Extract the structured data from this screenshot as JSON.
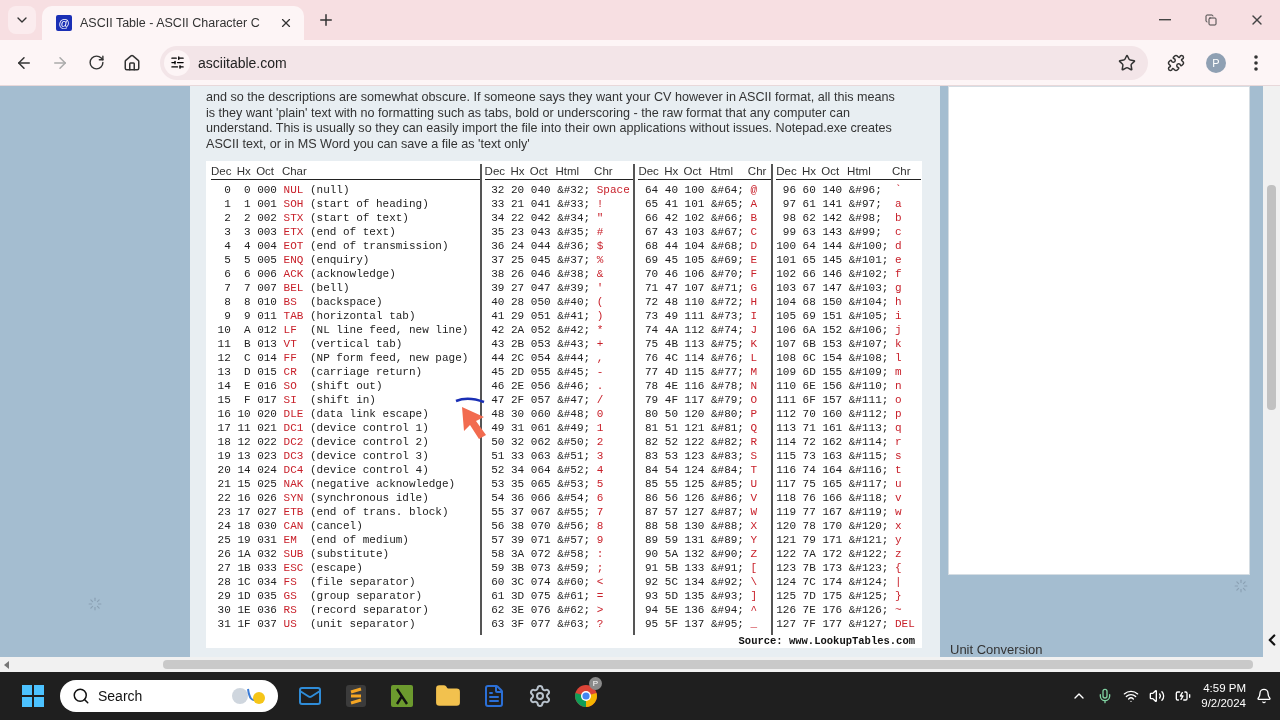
{
  "browser": {
    "tab_title": "ASCII Table - ASCII Character C",
    "favicon_glyph": "@",
    "url": "asciitable.com",
    "profile_initial": "P"
  },
  "page": {
    "intro": "and so the descriptions are somewhat obscure. If someone says they want your CV however in ASCII format, all this means is they want 'plain' text with no formatting such as tabs, bold or underscoring - the raw format that any computer can understand. This is usually so they can easily import the file into their own applications without issues. Notepad.exe creates ASCII text, or in MS Word you can save a file as 'text only'",
    "table": {
      "groups": [
        {
          "kind": "control",
          "columns": [
            "Dec",
            "Hx",
            "Oct",
            "Char"
          ],
          "rows": [
            [
              "0",
              "0",
              "000",
              "NUL",
              "(null)"
            ],
            [
              "1",
              "1",
              "001",
              "SOH",
              "(start of heading)"
            ],
            [
              "2",
              "2",
              "002",
              "STX",
              "(start of text)"
            ],
            [
              "3",
              "3",
              "003",
              "ETX",
              "(end of text)"
            ],
            [
              "4",
              "4",
              "004",
              "EOT",
              "(end of transmission)"
            ],
            [
              "5",
              "5",
              "005",
              "ENQ",
              "(enquiry)"
            ],
            [
              "6",
              "6",
              "006",
              "ACK",
              "(acknowledge)"
            ],
            [
              "7",
              "7",
              "007",
              "BEL",
              "(bell)"
            ],
            [
              "8",
              "8",
              "010",
              "BS",
              "(backspace)"
            ],
            [
              "9",
              "9",
              "011",
              "TAB",
              "(horizontal tab)"
            ],
            [
              "10",
              "A",
              "012",
              "LF",
              "(NL line feed, new line)"
            ],
            [
              "11",
              "B",
              "013",
              "VT",
              "(vertical tab)"
            ],
            [
              "12",
              "C",
              "014",
              "FF",
              "(NP form feed, new page)"
            ],
            [
              "13",
              "D",
              "015",
              "CR",
              "(carriage return)"
            ],
            [
              "14",
              "E",
              "016",
              "SO",
              "(shift out)"
            ],
            [
              "15",
              "F",
              "017",
              "SI",
              "(shift in)"
            ],
            [
              "16",
              "10",
              "020",
              "DLE",
              "(data link escape)"
            ],
            [
              "17",
              "11",
              "021",
              "DC1",
              "(device control 1)"
            ],
            [
              "18",
              "12",
              "022",
              "DC2",
              "(device control 2)"
            ],
            [
              "19",
              "13",
              "023",
              "DC3",
              "(device control 3)"
            ],
            [
              "20",
              "14",
              "024",
              "DC4",
              "(device control 4)"
            ],
            [
              "21",
              "15",
              "025",
              "NAK",
              "(negative acknowledge)"
            ],
            [
              "22",
              "16",
              "026",
              "SYN",
              "(synchronous idle)"
            ],
            [
              "23",
              "17",
              "027",
              "ETB",
              "(end of trans. block)"
            ],
            [
              "24",
              "18",
              "030",
              "CAN",
              "(cancel)"
            ],
            [
              "25",
              "19",
              "031",
              "EM",
              "(end of medium)"
            ],
            [
              "26",
              "1A",
              "032",
              "SUB",
              "(substitute)"
            ],
            [
              "27",
              "1B",
              "033",
              "ESC",
              "(escape)"
            ],
            [
              "28",
              "1C",
              "034",
              "FS",
              "(file separator)"
            ],
            [
              "29",
              "1D",
              "035",
              "GS",
              "(group separator)"
            ],
            [
              "30",
              "1E",
              "036",
              "RS",
              "(record separator)"
            ],
            [
              "31",
              "1F",
              "037",
              "US",
              "(unit separator)"
            ]
          ]
        },
        {
          "kind": "printable",
          "columns": [
            "Dec",
            "Hx",
            "Oct",
            "Html",
            "Chr"
          ],
          "rows": [
            [
              "32",
              "20",
              "040",
              "&#32;",
              "Space"
            ],
            [
              "33",
              "21",
              "041",
              "&#33;",
              "!"
            ],
            [
              "34",
              "22",
              "042",
              "&#34;",
              "\""
            ],
            [
              "35",
              "23",
              "043",
              "&#35;",
              "#"
            ],
            [
              "36",
              "24",
              "044",
              "&#36;",
              "$"
            ],
            [
              "37",
              "25",
              "045",
              "&#37;",
              "%"
            ],
            [
              "38",
              "26",
              "046",
              "&#38;",
              "&"
            ],
            [
              "39",
              "27",
              "047",
              "&#39;",
              "'"
            ],
            [
              "40",
              "28",
              "050",
              "&#40;",
              "("
            ],
            [
              "41",
              "29",
              "051",
              "&#41;",
              ")"
            ],
            [
              "42",
              "2A",
              "052",
              "&#42;",
              "*"
            ],
            [
              "43",
              "2B",
              "053",
              "&#43;",
              "+"
            ],
            [
              "44",
              "2C",
              "054",
              "&#44;",
              ","
            ],
            [
              "45",
              "2D",
              "055",
              "&#45;",
              "-"
            ],
            [
              "46",
              "2E",
              "056",
              "&#46;",
              "."
            ],
            [
              "47",
              "2F",
              "057",
              "&#47;",
              "/"
            ],
            [
              "48",
              "30",
              "060",
              "&#48;",
              "0"
            ],
            [
              "49",
              "31",
              "061",
              "&#49;",
              "1"
            ],
            [
              "50",
              "32",
              "062",
              "&#50;",
              "2"
            ],
            [
              "51",
              "33",
              "063",
              "&#51;",
              "3"
            ],
            [
              "52",
              "34",
              "064",
              "&#52;",
              "4"
            ],
            [
              "53",
              "35",
              "065",
              "&#53;",
              "5"
            ],
            [
              "54",
              "36",
              "066",
              "&#54;",
              "6"
            ],
            [
              "55",
              "37",
              "067",
              "&#55;",
              "7"
            ],
            [
              "56",
              "38",
              "070",
              "&#56;",
              "8"
            ],
            [
              "57",
              "39",
              "071",
              "&#57;",
              "9"
            ],
            [
              "58",
              "3A",
              "072",
              "&#58;",
              ":"
            ],
            [
              "59",
              "3B",
              "073",
              "&#59;",
              ";"
            ],
            [
              "60",
              "3C",
              "074",
              "&#60;",
              "<"
            ],
            [
              "61",
              "3D",
              "075",
              "&#61;",
              "="
            ],
            [
              "62",
              "3E",
              "076",
              "&#62;",
              ">"
            ],
            [
              "63",
              "3F",
              "077",
              "&#63;",
              "?"
            ]
          ]
        },
        {
          "kind": "printable",
          "columns": [
            "Dec",
            "Hx",
            "Oct",
            "Html",
            "Chr"
          ],
          "rows": [
            [
              "64",
              "40",
              "100",
              "&#64;",
              "@"
            ],
            [
              "65",
              "41",
              "101",
              "&#65;",
              "A"
            ],
            [
              "66",
              "42",
              "102",
              "&#66;",
              "B"
            ],
            [
              "67",
              "43",
              "103",
              "&#67;",
              "C"
            ],
            [
              "68",
              "44",
              "104",
              "&#68;",
              "D"
            ],
            [
              "69",
              "45",
              "105",
              "&#69;",
              "E"
            ],
            [
              "70",
              "46",
              "106",
              "&#70;",
              "F"
            ],
            [
              "71",
              "47",
              "107",
              "&#71;",
              "G"
            ],
            [
              "72",
              "48",
              "110",
              "&#72;",
              "H"
            ],
            [
              "73",
              "49",
              "111",
              "&#73;",
              "I"
            ],
            [
              "74",
              "4A",
              "112",
              "&#74;",
              "J"
            ],
            [
              "75",
              "4B",
              "113",
              "&#75;",
              "K"
            ],
            [
              "76",
              "4C",
              "114",
              "&#76;",
              "L"
            ],
            [
              "77",
              "4D",
              "115",
              "&#77;",
              "M"
            ],
            [
              "78",
              "4E",
              "116",
              "&#78;",
              "N"
            ],
            [
              "79",
              "4F",
              "117",
              "&#79;",
              "O"
            ],
            [
              "80",
              "50",
              "120",
              "&#80;",
              "P"
            ],
            [
              "81",
              "51",
              "121",
              "&#81;",
              "Q"
            ],
            [
              "82",
              "52",
              "122",
              "&#82;",
              "R"
            ],
            [
              "83",
              "53",
              "123",
              "&#83;",
              "S"
            ],
            [
              "84",
              "54",
              "124",
              "&#84;",
              "T"
            ],
            [
              "85",
              "55",
              "125",
              "&#85;",
              "U"
            ],
            [
              "86",
              "56",
              "126",
              "&#86;",
              "V"
            ],
            [
              "87",
              "57",
              "127",
              "&#87;",
              "W"
            ],
            [
              "88",
              "58",
              "130",
              "&#88;",
              "X"
            ],
            [
              "89",
              "59",
              "131",
              "&#89;",
              "Y"
            ],
            [
              "90",
              "5A",
              "132",
              "&#90;",
              "Z"
            ],
            [
              "91",
              "5B",
              "133",
              "&#91;",
              "["
            ],
            [
              "92",
              "5C",
              "134",
              "&#92;",
              "\\"
            ],
            [
              "93",
              "5D",
              "135",
              "&#93;",
              "]"
            ],
            [
              "94",
              "5E",
              "136",
              "&#94;",
              "^"
            ],
            [
              "95",
              "5F",
              "137",
              "&#95;",
              "_"
            ]
          ]
        },
        {
          "kind": "printable",
          "columns": [
            "Dec",
            "Hx",
            "Oct",
            "Html",
            "Chr"
          ],
          "rows": [
            [
              "96",
              "60",
              "140",
              "&#96;",
              "`"
            ],
            [
              "97",
              "61",
              "141",
              "&#97;",
              "a"
            ],
            [
              "98",
              "62",
              "142",
              "&#98;",
              "b"
            ],
            [
              "99",
              "63",
              "143",
              "&#99;",
              "c"
            ],
            [
              "100",
              "64",
              "144",
              "&#100;",
              "d"
            ],
            [
              "101",
              "65",
              "145",
              "&#101;",
              "e"
            ],
            [
              "102",
              "66",
              "146",
              "&#102;",
              "f"
            ],
            [
              "103",
              "67",
              "147",
              "&#103;",
              "g"
            ],
            [
              "104",
              "68",
              "150",
              "&#104;",
              "h"
            ],
            [
              "105",
              "69",
              "151",
              "&#105;",
              "i"
            ],
            [
              "106",
              "6A",
              "152",
              "&#106;",
              "j"
            ],
            [
              "107",
              "6B",
              "153",
              "&#107;",
              "k"
            ],
            [
              "108",
              "6C",
              "154",
              "&#108;",
              "l"
            ],
            [
              "109",
              "6D",
              "155",
              "&#109;",
              "m"
            ],
            [
              "110",
              "6E",
              "156",
              "&#110;",
              "n"
            ],
            [
              "111",
              "6F",
              "157",
              "&#111;",
              "o"
            ],
            [
              "112",
              "70",
              "160",
              "&#112;",
              "p"
            ],
            [
              "113",
              "71",
              "161",
              "&#113;",
              "q"
            ],
            [
              "114",
              "72",
              "162",
              "&#114;",
              "r"
            ],
            [
              "115",
              "73",
              "163",
              "&#115;",
              "s"
            ],
            [
              "116",
              "74",
              "164",
              "&#116;",
              "t"
            ],
            [
              "117",
              "75",
              "165",
              "&#117;",
              "u"
            ],
            [
              "118",
              "76",
              "166",
              "&#118;",
              "v"
            ],
            [
              "119",
              "77",
              "167",
              "&#119;",
              "w"
            ],
            [
              "120",
              "78",
              "170",
              "&#120;",
              "x"
            ],
            [
              "121",
              "79",
              "171",
              "&#121;",
              "y"
            ],
            [
              "122",
              "7A",
              "172",
              "&#122;",
              "z"
            ],
            [
              "123",
              "7B",
              "173",
              "&#123;",
              "{"
            ],
            [
              "124",
              "7C",
              "174",
              "&#124;",
              "|"
            ],
            [
              "125",
              "7D",
              "175",
              "&#125;",
              "}"
            ],
            [
              "126",
              "7E",
              "176",
              "&#126;",
              "~"
            ],
            [
              "127",
              "7F",
              "177",
              "&#127;",
              "DEL"
            ]
          ]
        }
      ],
      "source": "Source:  www.LookupTables.com"
    },
    "sidebar": {
      "heading": "Unit Conversion"
    }
  },
  "taskbar": {
    "search_label": "Search",
    "apps": [
      {
        "kind": "mail"
      },
      {
        "kind": "editor"
      },
      {
        "kind": "lambda"
      },
      {
        "kind": "folder"
      },
      {
        "kind": "document"
      },
      {
        "kind": "settings"
      },
      {
        "kind": "browser",
        "badge": "P"
      }
    ],
    "time": "4:59 PM",
    "date": "9/2/2024"
  }
}
